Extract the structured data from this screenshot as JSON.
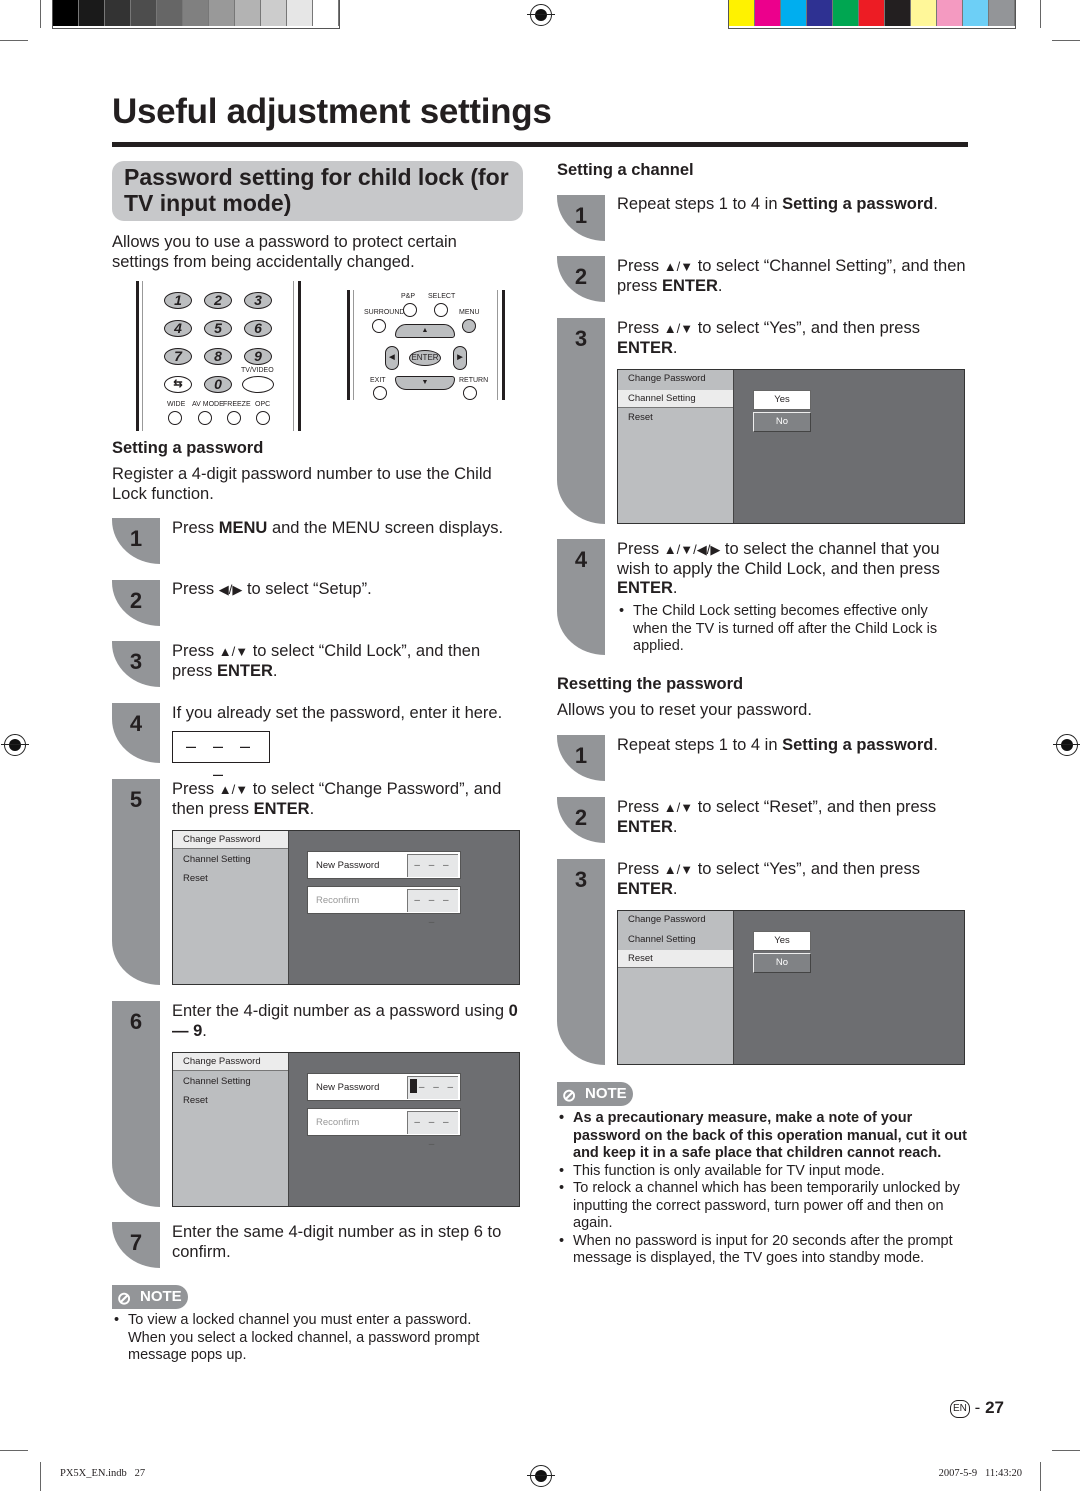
{
  "print_marks": {
    "gray_swatches": [
      "#000000",
      "#1a1a1a",
      "#333333",
      "#4d4d4d",
      "#666666",
      "#808080",
      "#999999",
      "#b3b3b3",
      "#cccccc",
      "#e6e6e6",
      "#ffffff"
    ],
    "color_swatches": [
      "#fff200",
      "#ec008c",
      "#00aeef",
      "#2e3192",
      "#00a651",
      "#ed1c24",
      "#231f20",
      "#fff799",
      "#f49ac1",
      "#6dcff6",
      "#939598"
    ]
  },
  "page": {
    "title": "Useful adjustment settings",
    "section_title": "Password setting for child lock (for TV input mode)",
    "intro": "Allows you to use a password to protect certain settings from being accidentally changed.",
    "accent_gray": "#939598"
  },
  "remote": {
    "numbers": [
      "1",
      "2",
      "3",
      "4",
      "5",
      "6",
      "7",
      "8",
      "9",
      "0"
    ],
    "labels": {
      "tv_video": "TV/VIDEO",
      "wide": "WIDE",
      "av_mode": "AV MODE",
      "freeze": "FREEZE",
      "opc": "OPC",
      "pp": "P&P",
      "select": "SELECT",
      "surround": "SURROUND",
      "menu": "MENU",
      "enter": "ENTER",
      "exit": "EXIT",
      "return": "RETURN"
    }
  },
  "setting_password": {
    "heading": "Setting a password",
    "intro": "Register a 4-digit password number to use the Child Lock function.",
    "steps": [
      {
        "num": "1",
        "pre": "Press ",
        "bold": "MENU",
        "post": " and the MENU screen displays."
      },
      {
        "num": "2",
        "pre": "Press ",
        "arrows": "◀/▶",
        "post": " to select “Setup”."
      },
      {
        "num": "3",
        "pre": "Press ",
        "arrows": "▲/▼",
        "post": " to select “Child Lock”, and then press ",
        "bold": "ENTER",
        "end": "."
      },
      {
        "num": "4",
        "text": "If you already set the password, enter it here.",
        "password_placeholder": "– – – –"
      },
      {
        "num": "5",
        "pre": "Press ",
        "arrows": "▲/▼",
        "post": " to select “Change Password”, and then press ",
        "bold": "ENTER",
        "end": "."
      },
      {
        "num": "6",
        "pre": "Enter the 4-digit number as a password using ",
        "bold": "0 — 9",
        "end": "."
      },
      {
        "num": "7",
        "text": "Enter the same 4-digit number as in step 6 to confirm."
      }
    ],
    "screen_step5": {
      "menu": [
        "Change Password",
        "Channel Setting",
        "Reset"
      ],
      "selected": "Change Password",
      "new_password_label": "New Password",
      "new_password_value": "– – – –",
      "reconfirm_label": "Reconfirm",
      "reconfirm_value": "– – – –"
    },
    "screen_step6": {
      "menu": [
        "Change Password",
        "Channel Setting",
        "Reset"
      ],
      "selected": "Change Password",
      "new_password_label": "New Password",
      "new_password_value": "– – –",
      "reconfirm_label": "Reconfirm",
      "reconfirm_value": "– – – –"
    },
    "note_label": "NOTE",
    "notes": [
      "To view a locked channel you must enter a password. When you select a locked channel, a password prompt message pops up."
    ]
  },
  "setting_channel": {
    "heading": "Setting a channel",
    "steps": [
      {
        "num": "1",
        "pre": "Repeat steps 1 to 4 in ",
        "bold": "Setting a password",
        "end": "."
      },
      {
        "num": "2",
        "pre": "Press ",
        "arrows": "▲/▼",
        "post": " to select “Channel Setting”, and then press ",
        "bold": "ENTER",
        "end": "."
      },
      {
        "num": "3",
        "pre": "Press ",
        "arrows": "▲/▼",
        "post": " to select “Yes”, and then press ",
        "bold": "ENTER",
        "end": "."
      },
      {
        "num": "4",
        "pre": "Press ",
        "arrows": "▲/▼/◀/▶",
        "post": " to select the channel that you wish to apply the Child Lock, and then press ",
        "bold": "ENTER",
        "end": ".",
        "bullet": "The Child Lock setting becomes effective only when the TV is turned off after the Child Lock is applied."
      }
    ],
    "screen": {
      "menu": [
        "Change Password",
        "Channel Setting",
        "Reset"
      ],
      "selected": "Channel Setting",
      "yes": "Yes",
      "no": "No"
    }
  },
  "resetting": {
    "heading": "Resetting the password",
    "intro": "Allows you to reset your password.",
    "steps": [
      {
        "num": "1",
        "pre": "Repeat steps 1 to 4 in ",
        "bold": "Setting a password",
        "end": "."
      },
      {
        "num": "2",
        "pre": "Press ",
        "arrows": "▲/▼",
        "post": " to select “Reset”, and then press ",
        "bold": "ENTER",
        "end": "."
      },
      {
        "num": "3",
        "pre": "Press ",
        "arrows": "▲/▼",
        "post": " to select “Yes”, and then press ",
        "bold": "ENTER",
        "end": "."
      }
    ],
    "screen": {
      "menu": [
        "Change Password",
        "Channel Setting",
        "Reset"
      ],
      "selected": "Reset",
      "yes": "Yes",
      "no": "No"
    },
    "note_label": "NOTE",
    "notes_bold": "As a precautionary measure, make a note of your password on the back of this operation manual, cut it out and keep it in a safe place that children cannot reach.",
    "notes": [
      "This function is only available for TV input mode.",
      "To relock a channel which has been temporarily unlocked by inputting the correct password, turn power off and then on again.",
      "When no password is input for 20 seconds after the prompt message is displayed, the TV goes into standby mode."
    ]
  },
  "footer": {
    "lang": "EN",
    "separator": "-",
    "page_number": "27",
    "slug_left": "PX5X_EN.indb   27",
    "slug_right": "2007-5-9   11:43:20"
  }
}
